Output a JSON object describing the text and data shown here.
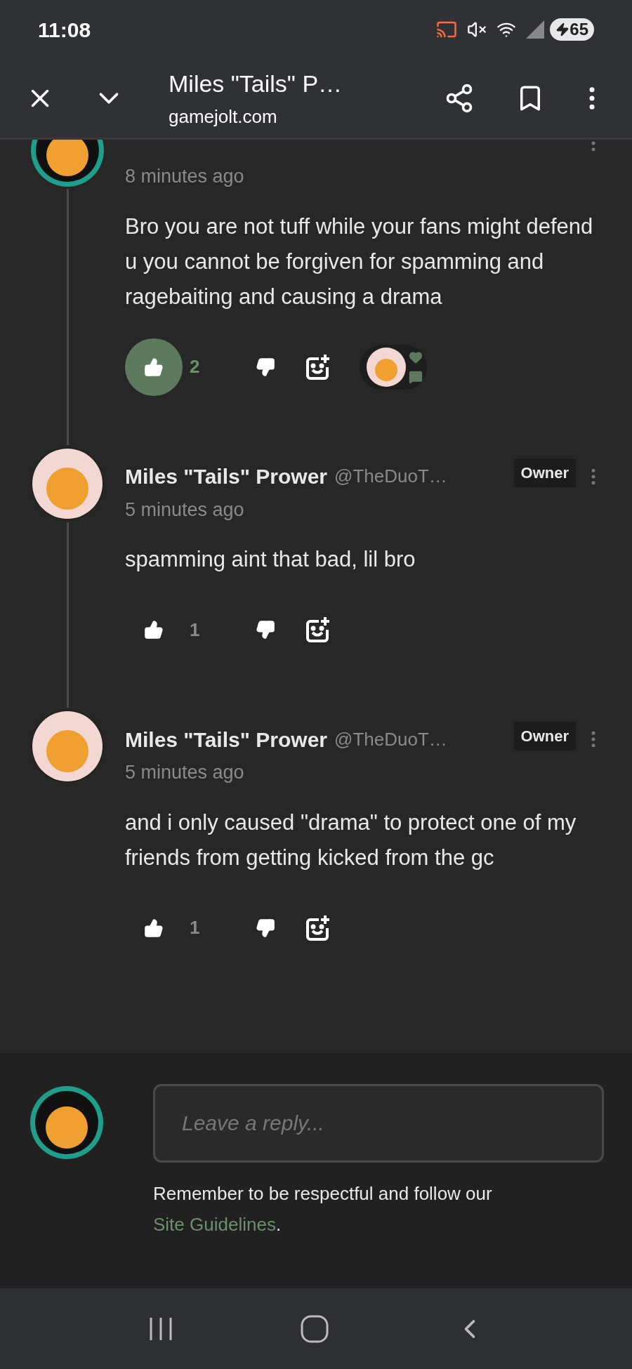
{
  "status_bar": {
    "time": "11:08",
    "battery": "65"
  },
  "browser_bar": {
    "title": "Miles \"Tails\" P…",
    "url": "gamejolt.com"
  },
  "comments": [
    {
      "time": "8 minutes ago",
      "body": "Bro you are not tuff while your fans might defend u you cannot be forgiven for spamming and ragebaiting and causing a drama",
      "likes": "2",
      "liked": true,
      "reaction_preview": true,
      "avatar_ring": true
    },
    {
      "author": "Miles \"Tails\" Prower",
      "handle": "@TheDuoT…",
      "badge": "Owner",
      "time": "5 minutes ago",
      "body": "spamming aint that bad, lil bro",
      "likes": "1",
      "liked": false,
      "reaction_preview": false,
      "avatar_ring": false
    },
    {
      "author": "Miles \"Tails\" Prower",
      "handle": "@TheDuoT…",
      "badge": "Owner",
      "time": "5 minutes ago",
      "body": "and i only caused \"drama\" to protect one of my friends from getting kicked from the gc",
      "likes": "1",
      "liked": false,
      "reaction_preview": false,
      "avatar_ring": false
    }
  ],
  "reply": {
    "placeholder": "Leave a reply...",
    "notice": "Remember to be respectful and follow our",
    "link": "Site Guidelines",
    "notice_end": "."
  }
}
